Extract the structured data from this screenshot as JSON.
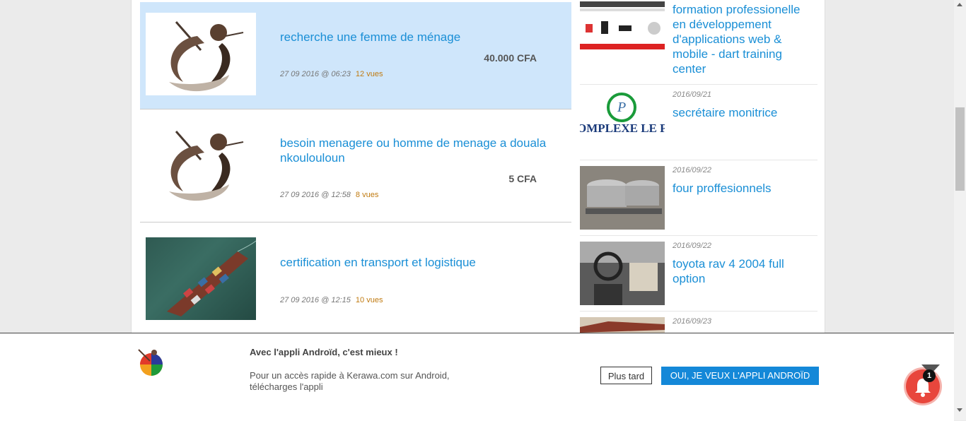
{
  "listings": [
    {
      "title": "recherche une femme de ménage",
      "price": "40.000 CFA",
      "date": "27 09 2016 @ 06:23",
      "views": "12 vues"
    },
    {
      "title": "besoin menagere ou homme de menage a douala nkoulouloun",
      "price": "5 CFA",
      "date": "27 09 2016 @ 12:58",
      "views": "8 vues"
    },
    {
      "title": "certification en transport et logistique",
      "date": "27 09 2016 @ 12:15",
      "views": "10 vues"
    }
  ],
  "sidebar": [
    {
      "title": "formation professionelle en développement d'applications web & mobile - dart training center"
    },
    {
      "date": "2016/09/21",
      "title": "secrétaire monitrice",
      "img_text": "OMPLEXE LE PREST"
    },
    {
      "date": "2016/09/22",
      "title": "four proffesionnels"
    },
    {
      "date": "2016/09/22",
      "title": "toyota rav 4 2004 full option"
    },
    {
      "date": "2016/09/23"
    }
  ],
  "banner": {
    "title": "Avec l'appli Androïd, c'est mieux !",
    "text": "Pour un accès rapide à Kerawa.com sur Android, télécharges l'appli",
    "later_label": "Plus tard",
    "yes_label": "OUI, JE VEUX L'APPLI ANDROÏD"
  },
  "notification": {
    "count": "1"
  },
  "colors": {
    "accent": "#1a8fd6",
    "highlight": "#cfe6fb",
    "button": "#1488d8",
    "views": "#c07a10"
  }
}
